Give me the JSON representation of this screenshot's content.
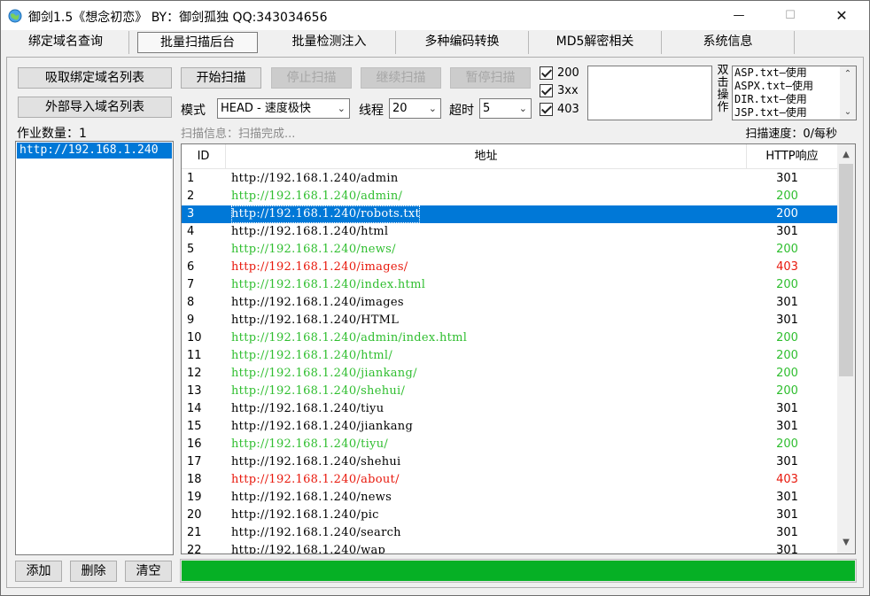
{
  "window": {
    "title": "御剑1.5《想念初恋》 BY：御剑孤独 QQ:343034656",
    "minimize_glyph": "—",
    "maximize_glyph": "☐",
    "close_glyph": "✕"
  },
  "tabs": [
    {
      "label": "绑定域名查询"
    },
    {
      "label": "批量扫描后台"
    },
    {
      "label": "批量检测注入"
    },
    {
      "label": "多种编码转换"
    },
    {
      "label": "MD5解密相关"
    },
    {
      "label": "系统信息"
    }
  ],
  "left": {
    "fetch_button": "吸取绑定域名列表",
    "import_button": "外部导入域名列表",
    "job_count_label": "作业数量：1",
    "domains": [
      "http://192.168.1.240"
    ],
    "add_button": "添加",
    "delete_button": "删除",
    "clear_button": "清空"
  },
  "controls": {
    "start_button": "开始扫描",
    "stop_button": "停止扫描",
    "continue_button": "继续扫描",
    "pause_button": "暂停扫描",
    "mode_label": "模式",
    "mode_value": "HEAD - 速度极快",
    "threads_label": "线程",
    "threads_value": "20",
    "timeout_label": "超时",
    "timeout_value": "5",
    "chk_200": "200",
    "chk_3xx": "3xx",
    "chk_403": "403",
    "dict_side_label": [
      "双",
      "击",
      "操",
      "作"
    ],
    "dict_items": [
      "ASP.txt—使用",
      "ASPX.txt—使用",
      "DIR.txt—使用",
      "JSP.txt—使用"
    ]
  },
  "status": {
    "scan_info": "扫描信息：扫描完成...",
    "scan_speed": "扫描速度：0/每秒"
  },
  "table": {
    "headers": {
      "id": "ID",
      "url": "地址",
      "code": "HTTP响应"
    },
    "selected_index": 2,
    "colors": {
      "200": "#2fbe2f",
      "301": "#000000",
      "403": "#e8180c"
    },
    "rows": [
      {
        "id": "1",
        "url": "http://192.168.1.240/admin",
        "code": "301"
      },
      {
        "id": "2",
        "url": "http://192.168.1.240/admin/",
        "code": "200"
      },
      {
        "id": "3",
        "url": "http://192.168.1.240/robots.txt",
        "code": "200"
      },
      {
        "id": "4",
        "url": "http://192.168.1.240/html",
        "code": "301"
      },
      {
        "id": "5",
        "url": "http://192.168.1.240/news/",
        "code": "200"
      },
      {
        "id": "6",
        "url": "http://192.168.1.240/images/",
        "code": "403"
      },
      {
        "id": "7",
        "url": "http://192.168.1.240/index.html",
        "code": "200"
      },
      {
        "id": "8",
        "url": "http://192.168.1.240/images",
        "code": "301"
      },
      {
        "id": "9",
        "url": "http://192.168.1.240/HTML",
        "code": "301"
      },
      {
        "id": "10",
        "url": "http://192.168.1.240/admin/index.html",
        "code": "200"
      },
      {
        "id": "11",
        "url": "http://192.168.1.240/html/",
        "code": "200"
      },
      {
        "id": "12",
        "url": "http://192.168.1.240/jiankang/",
        "code": "200"
      },
      {
        "id": "13",
        "url": "http://192.168.1.240/shehui/",
        "code": "200"
      },
      {
        "id": "14",
        "url": "http://192.168.1.240/tiyu",
        "code": "301"
      },
      {
        "id": "15",
        "url": "http://192.168.1.240/jiankang",
        "code": "301"
      },
      {
        "id": "16",
        "url": "http://192.168.1.240/tiyu/",
        "code": "200"
      },
      {
        "id": "17",
        "url": "http://192.168.1.240/shehui",
        "code": "301"
      },
      {
        "id": "18",
        "url": "http://192.168.1.240/about/",
        "code": "403"
      },
      {
        "id": "19",
        "url": "http://192.168.1.240/news",
        "code": "301"
      },
      {
        "id": "20",
        "url": "http://192.168.1.240/pic",
        "code": "301"
      },
      {
        "id": "21",
        "url": "http://192.168.1.240/search",
        "code": "301"
      },
      {
        "id": "22",
        "url": "http://192.168.1.240/wap",
        "code": "301"
      }
    ]
  },
  "progress": {
    "fraction": 1.0,
    "color": "#06b025"
  }
}
